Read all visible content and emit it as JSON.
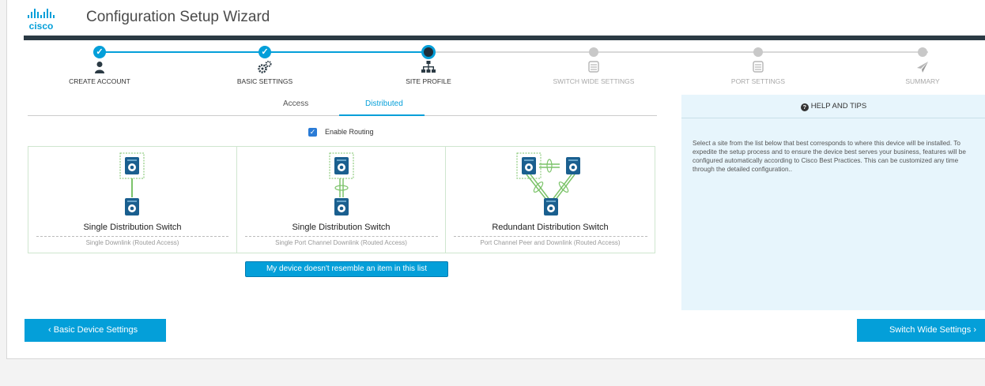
{
  "header": {
    "logo_text": "cisco",
    "title": "Configuration Setup Wizard"
  },
  "wizard": {
    "steps": [
      {
        "label": "CREATE ACCOUNT",
        "state": "done",
        "icon": "user-icon"
      },
      {
        "label": "BASIC SETTINGS",
        "state": "done",
        "icon": "gears-icon"
      },
      {
        "label": "SITE PROFILE",
        "state": "current",
        "icon": "sitemap-icon"
      },
      {
        "label": "SWITCH WIDE SETTINGS",
        "state": "todo",
        "icon": "switch-icon"
      },
      {
        "label": "PORT SETTINGS",
        "state": "todo",
        "icon": "switch-icon"
      },
      {
        "label": "SUMMARY",
        "state": "todo",
        "icon": "paper-plane-icon"
      }
    ]
  },
  "tabs": {
    "access": "Access",
    "distributed": "Distributed",
    "active": "Distributed"
  },
  "routing": {
    "label": "Enable Routing",
    "checked": true
  },
  "cards": [
    {
      "title": "Single Distribution Switch",
      "subtitle": "Single Downlink (Routed Access)"
    },
    {
      "title": "Single Distribution Switch",
      "subtitle": "Single Port Channel Downlink (Routed Access)"
    },
    {
      "title": "Redundant Distribution Switch",
      "subtitle": "Port Channel Peer and Downlink (Routed Access)"
    }
  ],
  "no_match_label": "My device doesn't resemble an item in this list",
  "help": {
    "title": "HELP AND TIPS",
    "text": "Select a site from the list below that best corresponds to where this device will be installed. To expedite the setup process and to ensure the device best serves your business, features will be configured automatically according to Cisco Best Practices. This can be customized any time through the detailed configuration.."
  },
  "footer": {
    "back_label": "‹ Basic Device Settings",
    "next_label": "Switch Wide Settings ›"
  },
  "colors": {
    "accent": "#049fd9",
    "dark_bar": "#2b3a44",
    "help_bg": "#e7f5fc",
    "switch_blue": "#1a5f8f"
  }
}
